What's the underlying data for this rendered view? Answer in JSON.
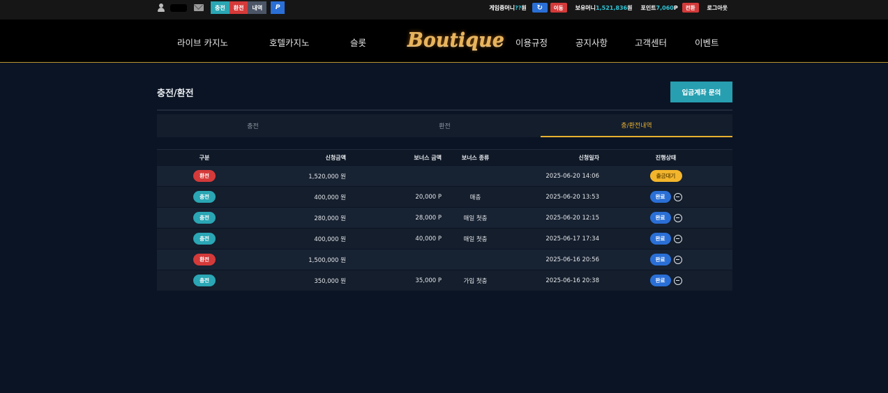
{
  "topbar": {
    "seg_charge": "충전",
    "seg_exchange": "환전",
    "seg_history": "내역",
    "point_icon": "P",
    "game_money_label": "게임중머니",
    "game_money_value": "??",
    "game_money_unit": "원",
    "move_label": "이동",
    "holding_money_label": "보유머니",
    "holding_money_value": "1,521,836",
    "holding_money_unit": "원",
    "point_label": "포인트",
    "point_value": "7,060",
    "point_unit": "P",
    "convert_label": "전환",
    "logout_label": "로그아웃"
  },
  "nav": {
    "items": [
      "라이브 카지노",
      "호텔카지노",
      "슬롯",
      "이용규정",
      "공지사항",
      "고객센터",
      "이벤트"
    ],
    "logo": "Boutique"
  },
  "page": {
    "title": "충전/환전",
    "inquiry_button": "입금계좌 문의"
  },
  "tabs": [
    "충전",
    "환전",
    "충/환전내역"
  ],
  "table": {
    "headers": [
      "구분",
      "신청금액",
      "보너스 금액",
      "보너스 종류",
      "신청일자",
      "진행상태"
    ],
    "rows": [
      {
        "type": "환전",
        "amount": "1,520,000 원",
        "bonus": "",
        "bonus_type": "",
        "date": "2025-06-20 14:06",
        "status": "출금대기"
      },
      {
        "type": "충전",
        "amount": "400,000 원",
        "bonus": "20,000 P",
        "bonus_type": "매충",
        "date": "2025-06-20 13:53",
        "status": "완료"
      },
      {
        "type": "충전",
        "amount": "280,000 원",
        "bonus": "28,000 P",
        "bonus_type": "매일 첫충",
        "date": "2025-06-20 12:15",
        "status": "완료"
      },
      {
        "type": "충전",
        "amount": "400,000 원",
        "bonus": "40,000 P",
        "bonus_type": "매일 첫충",
        "date": "2025-06-17 17:34",
        "status": "완료"
      },
      {
        "type": "환전",
        "amount": "1,500,000 원",
        "bonus": "",
        "bonus_type": "",
        "date": "2025-06-16 20:56",
        "status": "완료"
      },
      {
        "type": "충전",
        "amount": "350,000 원",
        "bonus": "35,000 P",
        "bonus_type": "가입 첫충",
        "date": "2025-06-16 20:38",
        "status": "완료"
      }
    ]
  },
  "colors": {
    "accent_gold": "#e8b030",
    "charge_teal": "#2aa6b4",
    "exchange_red": "#d43a3a",
    "done_blue": "#2a6fd6",
    "pending_yellow": "#f3b52c"
  }
}
